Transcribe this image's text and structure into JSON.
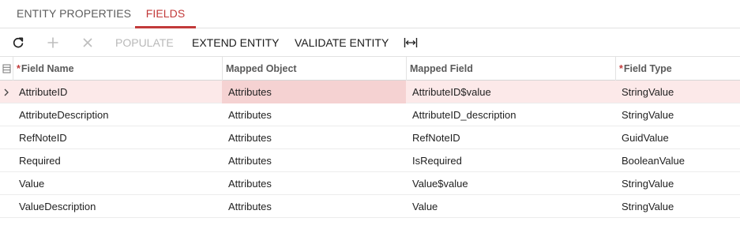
{
  "tabs": [
    {
      "label": "ENTITY PROPERTIES"
    },
    {
      "label": "FIELDS"
    }
  ],
  "active_tab": "FIELDS",
  "toolbar": {
    "refresh_icon": "refresh-icon",
    "add_icon": "plus-icon",
    "delete_icon": "close-icon",
    "populate_label": "POPULATE",
    "extend_label": "EXTEND ENTITY",
    "validate_label": "VALIDATE ENTITY",
    "fit_icon": "fit-columns-icon"
  },
  "grid": {
    "columns": [
      {
        "label": "Field Name",
        "required": "*"
      },
      {
        "label": "Mapped Object",
        "required": ""
      },
      {
        "label": "Mapped Field",
        "required": ""
      },
      {
        "label": "Field Type",
        "required": "*"
      }
    ],
    "rows": [
      {
        "field_name": "AttributeID",
        "mapped_object": "Attributes",
        "mapped_field": "AttributeID$value",
        "field_type": "StringValue"
      },
      {
        "field_name": "AttributeDescription",
        "mapped_object": "Attributes",
        "mapped_field": "AttributeID_description",
        "field_type": "StringValue"
      },
      {
        "field_name": "RefNoteID",
        "mapped_object": "Attributes",
        "mapped_field": "RefNoteID",
        "field_type": "GuidValue"
      },
      {
        "field_name": "Required",
        "mapped_object": "Attributes",
        "mapped_field": "IsRequired",
        "field_type": "BooleanValue"
      },
      {
        "field_name": "Value",
        "mapped_object": "Attributes",
        "mapped_field": "Value$value",
        "field_type": "StringValue"
      },
      {
        "field_name": "ValueDescription",
        "mapped_object": "Attributes",
        "mapped_field": "Value",
        "field_type": "StringValue"
      }
    ]
  },
  "colors": {
    "accent": "#c23a3a",
    "active_row": "#fce9e9",
    "active_cell": "#f5d2d2",
    "disabled": "#b9b9b9"
  }
}
